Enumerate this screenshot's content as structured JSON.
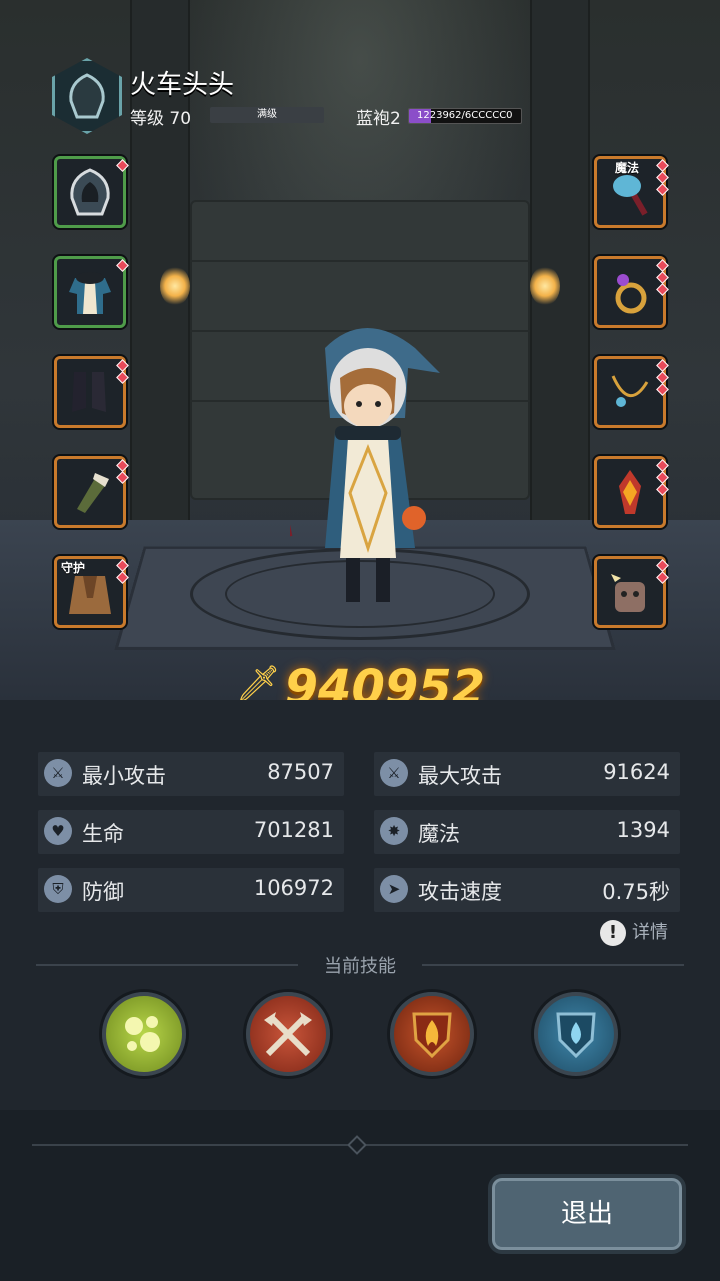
{
  "player": {
    "name": "火车头头",
    "level_label": "等级 70",
    "level_bar_text": "满级",
    "robe_label": "蓝袍2",
    "robe_progress_text": "1223962/6CCCCC0",
    "robe_progress_fraction": 0.2
  },
  "equipment": {
    "left": [
      {
        "icon": "hood-icon",
        "border": "green"
      },
      {
        "icon": "robe-armor-icon",
        "border": "green"
      },
      {
        "icon": "boots-icon",
        "border": "orange"
      },
      {
        "icon": "bracer-icon",
        "border": "orange"
      },
      {
        "icon": "cloak-icon",
        "border": "orange",
        "tag": "守护"
      }
    ],
    "right": [
      {
        "icon": "staff-icon",
        "border": "orange",
        "tag": "魔法"
      },
      {
        "icon": "ring-icon",
        "border": "orange"
      },
      {
        "icon": "necklace-icon",
        "border": "orange"
      },
      {
        "icon": "flame-emblem-icon",
        "border": "orange"
      },
      {
        "icon": "pet-icon",
        "border": "orange"
      }
    ]
  },
  "power": {
    "value": "940952"
  },
  "stats": [
    {
      "label": "最小攻击",
      "value": "87507",
      "icon": "sword-icon"
    },
    {
      "label": "最大攻击",
      "value": "91624",
      "icon": "sword-icon"
    },
    {
      "label": "生命",
      "value": "701281",
      "icon": "heart-icon"
    },
    {
      "label": "魔法",
      "value": "1394",
      "icon": "magic-icon"
    },
    {
      "label": "防御",
      "value": "106972",
      "icon": "shield-icon"
    },
    {
      "label": "攻击速度",
      "value": "0.75秒",
      "icon": "speed-icon"
    }
  ],
  "details_label": "详情",
  "skills_title": "当前技能",
  "skills": [
    {
      "icon": "bubbles-skill-icon",
      "color": "#9bc23a"
    },
    {
      "icon": "crossed-axes-skill-icon",
      "color": "#b2452d"
    },
    {
      "icon": "fire-shield-skill-icon",
      "color": "#a8421e"
    },
    {
      "icon": "water-drop-skill-icon",
      "color": "#2e6a8c"
    }
  ],
  "exit_label": "退出",
  "colors": {
    "power": "#ffd04a",
    "panel": "#20262d",
    "stat_bg": "#2a3139"
  }
}
